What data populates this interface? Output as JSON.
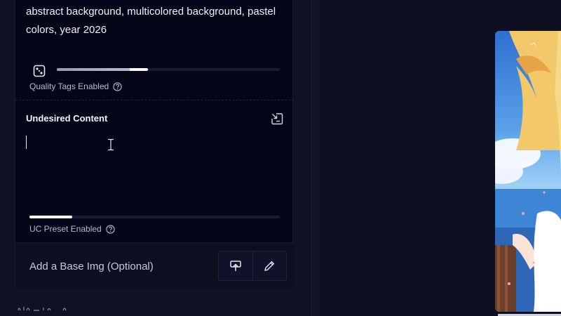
{
  "prompt": {
    "text": "abstract background, multicolored background, pastel colors, year 2026",
    "quality_slider": {
      "fill_fraction": 0.41,
      "highlight_color": "#ffffff"
    },
    "quality_label": "Quality Tags Enabled"
  },
  "undesired": {
    "title": "Undesired Content",
    "value": "",
    "preset_slider": {
      "fill_fraction": 0.17
    },
    "preset_label": "UC Preset Enabled"
  },
  "base_image": {
    "label": "Add a Base Img (Optional)",
    "upload_icon": "upload-icon",
    "draw_icon": "pencil-icon"
  },
  "colors": {
    "panel_bg": "#050518",
    "page_bg": "#0e1022",
    "slider_track": "#1a1c35",
    "slider_fill": "#b9bbc8"
  }
}
